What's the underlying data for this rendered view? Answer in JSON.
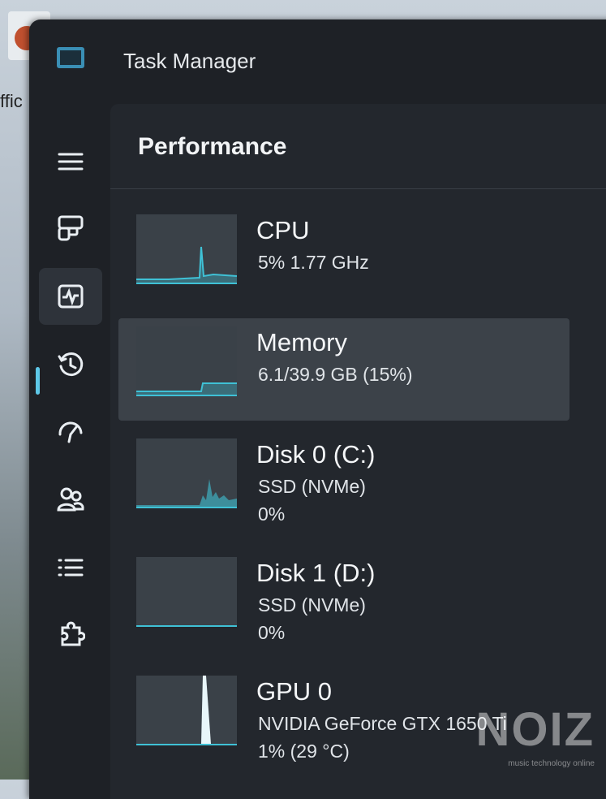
{
  "desktop": {
    "label_fragment": "ffic"
  },
  "window": {
    "title": "Task Manager"
  },
  "sidebar": {
    "items": [
      {
        "name": "hamburger-menu"
      },
      {
        "name": "processes"
      },
      {
        "name": "performance"
      },
      {
        "name": "app-history"
      },
      {
        "name": "startup-apps"
      },
      {
        "name": "users"
      },
      {
        "name": "details"
      },
      {
        "name": "services"
      }
    ],
    "active_index": 2
  },
  "page": {
    "title": "Performance"
  },
  "performance_items": [
    {
      "name": "CPU",
      "line1": "5%  1.77 GHz",
      "line2": ""
    },
    {
      "name": "Memory",
      "line1": "6.1/39.9 GB (15%)",
      "line2": ""
    },
    {
      "name": "Disk 0 (C:)",
      "line1": "SSD (NVMe)",
      "line2": "0%"
    },
    {
      "name": "Disk 1 (D:)",
      "line1": "SSD (NVMe)",
      "line2": "0%"
    },
    {
      "name": "GPU 0",
      "line1": "NVIDIA GeForce GTX 1650 Ti",
      "line2": "1%  (29 °C)"
    }
  ],
  "selected_item": "Memory",
  "colors": {
    "accent": "#3fc1d6",
    "window_bg": "#1e2126",
    "selected_bg": "#3c4249"
  },
  "watermark": {
    "text": "NOIZ",
    "subtext": "music technology online"
  }
}
